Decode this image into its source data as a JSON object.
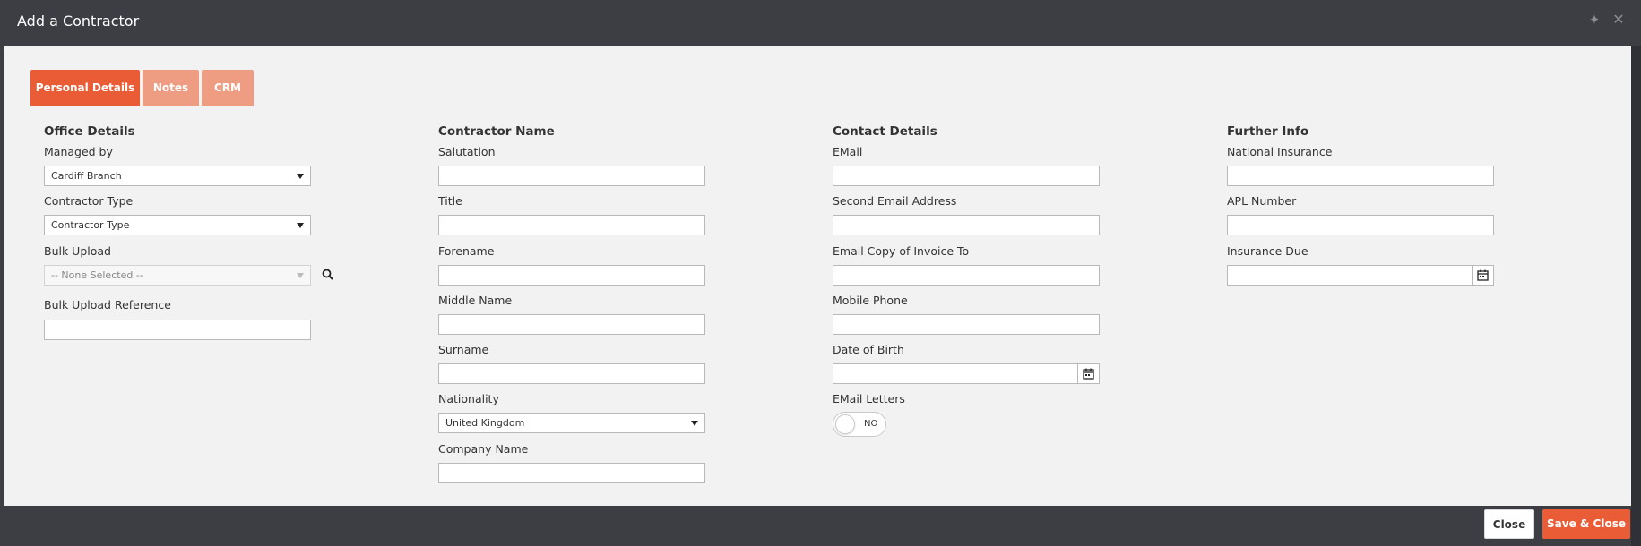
{
  "dialog": {
    "title": "Add a Contractor"
  },
  "tabs": [
    {
      "label": "Personal Details",
      "active": true
    },
    {
      "label": "Notes",
      "active": false
    },
    {
      "label": "CRM",
      "active": false
    }
  ],
  "office": {
    "title": "Office Details",
    "managed_by_label": "Managed by",
    "managed_by_value": "Cardiff Branch",
    "contractor_type_label": "Contractor Type",
    "contractor_type_value": "Contractor Type",
    "bulk_upload_label": "Bulk Upload",
    "bulk_upload_value": "-- None Selected --",
    "bulk_upload_reference_label": "Bulk Upload Reference",
    "bulk_upload_reference_value": ""
  },
  "name": {
    "title": "Contractor Name",
    "salutation_label": "Salutation",
    "title_label": "Title",
    "forename_label": "Forename",
    "middle_name_label": "Middle Name",
    "surname_label": "Surname",
    "nationality_label": "Nationality",
    "nationality_value": "United Kingdom",
    "company_name_label": "Company Name"
  },
  "contact": {
    "title": "Contact Details",
    "email_label": "EMail",
    "second_email_label": "Second Email Address",
    "invoice_email_label": "Email Copy of Invoice To",
    "mobile_label": "Mobile Phone",
    "dob_label": "Date of Birth",
    "email_letters_label": "EMail Letters",
    "email_letters_state": "NO"
  },
  "further": {
    "title": "Further Info",
    "ni_label": "National Insurance",
    "apl_label": "APL Number",
    "insurance_due_label": "Insurance Due"
  },
  "footer": {
    "close_label": "Close",
    "save_close_label": "Save & Close"
  },
  "colors": {
    "accent": "#ea5c35",
    "tab_inactive": "#ef9d82",
    "header_bg": "#3c3e43"
  },
  "icons": {
    "search": "search-icon",
    "calendar": "calendar-icon",
    "pin": "pin-icon",
    "close": "close-icon"
  }
}
